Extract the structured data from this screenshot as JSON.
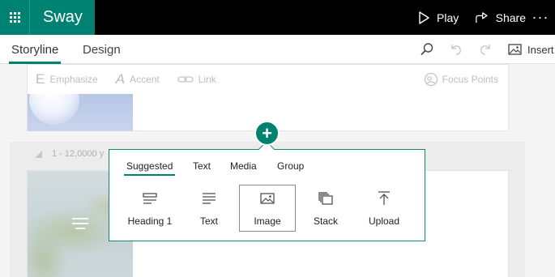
{
  "app": {
    "name": "Sway"
  },
  "topbar": {
    "play_label": "Play",
    "share_label": "Share",
    "more_label": "···"
  },
  "subbar": {
    "tabs": [
      {
        "label": "Storyline",
        "active": true
      },
      {
        "label": "Design",
        "active": false
      }
    ],
    "insert_label": "Insert",
    "icons": [
      "search-icon",
      "undo-icon",
      "redo-icon",
      "insert-image-icon"
    ]
  },
  "format_toolbar": {
    "emphasize": {
      "glyph": "E",
      "label": "Emphasize"
    },
    "accent": {
      "glyph": "A",
      "label": "Accent"
    },
    "link": {
      "label": "Link"
    },
    "focus_points": {
      "label": "Focus Points"
    }
  },
  "section": {
    "label": "1 - 12,0000 y"
  },
  "insert_popup": {
    "tabs": [
      {
        "label": "Suggested",
        "active": true
      },
      {
        "label": "Text",
        "active": false
      },
      {
        "label": "Media",
        "active": false
      },
      {
        "label": "Group",
        "active": false
      }
    ],
    "items": [
      {
        "label": "Heading 1",
        "icon": "heading-icon"
      },
      {
        "label": "Text",
        "icon": "text-lines-icon"
      },
      {
        "label": "Image",
        "icon": "image-icon",
        "selected": true
      },
      {
        "label": "Stack",
        "icon": "stack-icon"
      },
      {
        "label": "Upload",
        "icon": "upload-icon"
      }
    ]
  },
  "colors": {
    "brand": "#008272",
    "topbar": "#000000",
    "popup_border": "#0f8a7a"
  }
}
